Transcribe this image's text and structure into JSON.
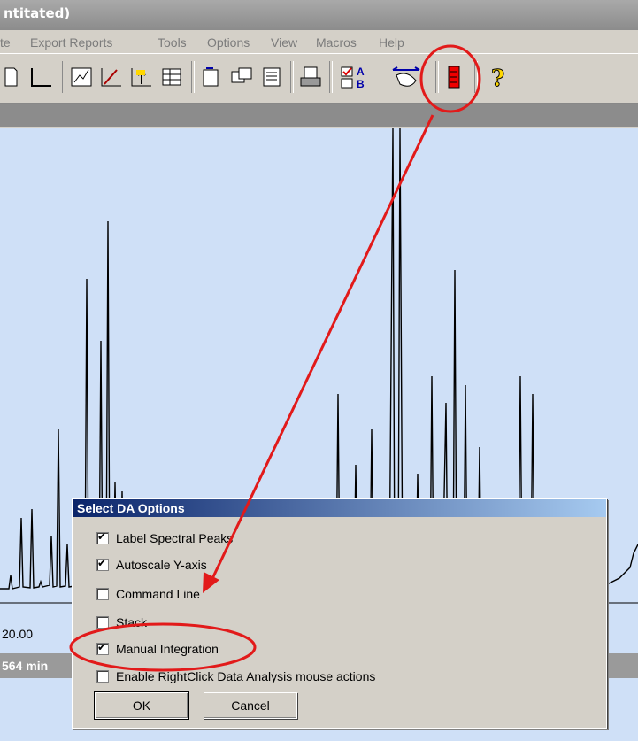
{
  "window": {
    "title_fragment": "ntitated)"
  },
  "menu": [
    "te",
    "Export Reports",
    "Tools",
    "Options",
    "View",
    "Macros",
    "Help"
  ],
  "toolbar": {
    "icons": [
      "document-icon",
      "blank-frame-icon",
      "chart-select-icon",
      "chart-edit-icon",
      "chart-up-icon",
      "table-icon",
      "copy-icon",
      "transfer-icon",
      "report-icon",
      "print-report-icon",
      "select-da-options-icon",
      "mouse-hand-icon",
      "red-marker-icon",
      "help-icon"
    ]
  },
  "chromatogram": {
    "axis_label": "20.00",
    "status_text": "564 min"
  },
  "dialog": {
    "title": "Select DA Options",
    "options": [
      {
        "label": "Label Spectral Peaks",
        "checked": true
      },
      {
        "label": "Autoscale Y-axis",
        "checked": true
      },
      {
        "label": "Command Line",
        "checked": false
      },
      {
        "label": "Stack",
        "checked": false
      },
      {
        "label": "Manual Integration",
        "checked": true
      },
      {
        "label": "Enable RightClick Data Analysis mouse actions",
        "checked": false
      }
    ],
    "ok_label": "OK",
    "cancel_label": "Cancel"
  },
  "annotation_color": "#e21a1a"
}
